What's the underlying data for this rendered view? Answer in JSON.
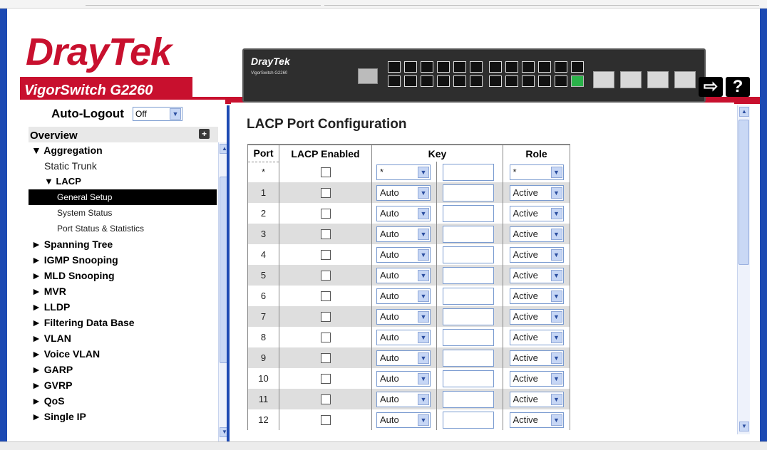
{
  "header": {
    "brand_primary": "Dray",
    "brand_secondary": "Tek",
    "model": "VigorSwitch G2260",
    "device_brand": "DrayTek",
    "device_model": "VigorSwitch G2260",
    "logout_icon": "logout-arrow-icon",
    "help_label": "?"
  },
  "sidebar": {
    "auto_logout_label": "Auto-Logout",
    "auto_logout_value": "Off",
    "overview_label": "Overview",
    "items": [
      {
        "label": "▼ Aggregation",
        "level": "top"
      },
      {
        "label": "Static Trunk",
        "level": "sub"
      },
      {
        "label": "▼ LACP",
        "level": "subtop"
      },
      {
        "label": "General Setup",
        "level": "leaf",
        "active": true
      },
      {
        "label": "System Status",
        "level": "leaf"
      },
      {
        "label": "Port Status & Statistics",
        "level": "leaf"
      },
      {
        "label": "► Spanning Tree",
        "level": "top"
      },
      {
        "label": "► IGMP Snooping",
        "level": "top"
      },
      {
        "label": "► MLD Snooping",
        "level": "top"
      },
      {
        "label": "► MVR",
        "level": "top"
      },
      {
        "label": "► LLDP",
        "level": "top"
      },
      {
        "label": "► Filtering Data Base",
        "level": "top"
      },
      {
        "label": "► VLAN",
        "level": "top"
      },
      {
        "label": "► Voice VLAN",
        "level": "top"
      },
      {
        "label": "► GARP",
        "level": "top"
      },
      {
        "label": "► GVRP",
        "level": "top"
      },
      {
        "label": "► QoS",
        "level": "top"
      },
      {
        "label": "► Single IP",
        "level": "top"
      }
    ]
  },
  "main": {
    "title": "LACP Port Configuration",
    "columns": {
      "port": "Port",
      "lacp_enabled": "LACP Enabled",
      "key": "Key",
      "role": "Role"
    },
    "rows": [
      {
        "port": "*",
        "key": "*",
        "role": "*"
      },
      {
        "port": "1",
        "key": "Auto",
        "role": "Active"
      },
      {
        "port": "2",
        "key": "Auto",
        "role": "Active"
      },
      {
        "port": "3",
        "key": "Auto",
        "role": "Active"
      },
      {
        "port": "4",
        "key": "Auto",
        "role": "Active"
      },
      {
        "port": "5",
        "key": "Auto",
        "role": "Active"
      },
      {
        "port": "6",
        "key": "Auto",
        "role": "Active"
      },
      {
        "port": "7",
        "key": "Auto",
        "role": "Active"
      },
      {
        "port": "8",
        "key": "Auto",
        "role": "Active"
      },
      {
        "port": "9",
        "key": "Auto",
        "role": "Active"
      },
      {
        "port": "10",
        "key": "Auto",
        "role": "Active"
      },
      {
        "port": "11",
        "key": "Auto",
        "role": "Active"
      },
      {
        "port": "12",
        "key": "Auto",
        "role": "Active"
      }
    ]
  },
  "colors": {
    "brand_red": "#c8102e",
    "frame_blue": "#1d4ab3",
    "active_menu_bg": "#000000",
    "alt_row": "#dedede"
  }
}
